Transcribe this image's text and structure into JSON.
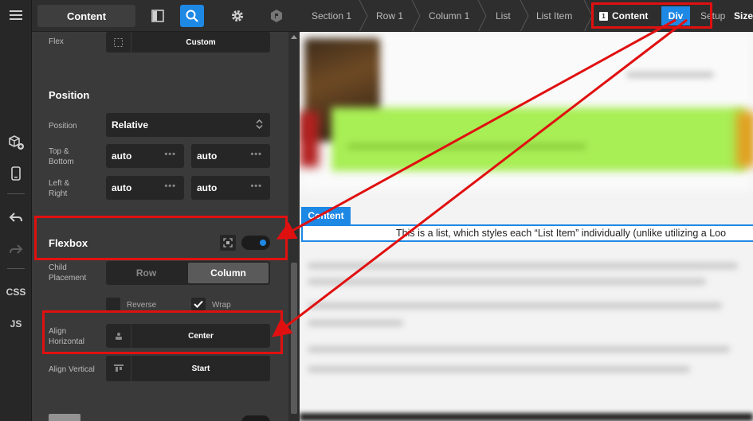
{
  "topbar": {
    "content_tab": "Content"
  },
  "rail": {
    "css": "CSS",
    "js": "JS"
  },
  "panel": {
    "flex": {
      "label": "Flex",
      "value": "Custom"
    },
    "position_section": {
      "title": "Position"
    },
    "position": {
      "label": "Position",
      "value": "Relative"
    },
    "top_bottom": {
      "label_line1": "Top &",
      "label_line2": "Bottom",
      "value1": "auto",
      "value2": "auto"
    },
    "left_right": {
      "label_line1": "Left &",
      "label_line2": "Right",
      "value1": "auto",
      "value2": "auto"
    },
    "flexbox_section": {
      "title": "Flexbox",
      "enabled": true
    },
    "child_placement": {
      "label_line1": "Child",
      "label_line2": "Placement",
      "options": [
        "Row",
        "Column"
      ],
      "selected": "Column"
    },
    "reverse": {
      "label": "Reverse",
      "checked": false
    },
    "wrap": {
      "label": "Wrap",
      "checked": true
    },
    "align_horizontal": {
      "label_line1": "Align",
      "label_line2": "Horizontal",
      "value": "Center"
    },
    "align_vertical": {
      "label": "Align Vertical",
      "value": "Start"
    }
  },
  "breadcrumbs": [
    {
      "label": "Section 1"
    },
    {
      "label": "Row 1"
    },
    {
      "label": "Column 1"
    },
    {
      "label": "List"
    },
    {
      "label": "List Item"
    },
    {
      "label": "Content",
      "badge": "1"
    },
    {
      "label": "Div"
    },
    {
      "label": "Setup"
    },
    {
      "label": "Size"
    }
  ],
  "preview": {
    "content_tag": "Content",
    "list_text": "This is a list, which styles each “List Item” individually (unlike utilizing a Loo"
  },
  "colors": {
    "accent": "#1e88e5",
    "annotation": "#e01010",
    "highlight_green": "#a8ee55"
  }
}
